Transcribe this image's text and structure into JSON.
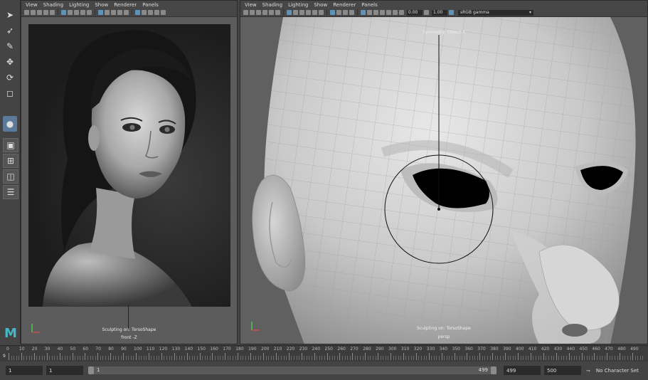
{
  "left_panel": {
    "menu": [
      "View",
      "Shading",
      "Lighting",
      "Show",
      "Renderer",
      "Panels"
    ],
    "status": "Sculpting on: TorsoShape",
    "camera": "front -Z"
  },
  "right_panel": {
    "menu": [
      "View",
      "Shading",
      "Lighting",
      "Show",
      "Renderer",
      "Panels"
    ],
    "exposure": "0.00",
    "gamma": "1.00",
    "color_space": "sRGB gamma",
    "symmetry": "Symmetry: Object X",
    "status": "Sculpting on: TorsoShape",
    "camera": "persp"
  },
  "timeline": {
    "ticks": [
      "0",
      "10",
      "20",
      "30",
      "40",
      "50",
      "60",
      "70",
      "80",
      "90",
      "100",
      "110",
      "120",
      "130",
      "140",
      "150",
      "160",
      "170",
      "180",
      "190",
      "200",
      "210",
      "220",
      "230",
      "240",
      "250",
      "260",
      "270",
      "280",
      "290",
      "300",
      "310",
      "320",
      "330",
      "340",
      "350",
      "360",
      "370",
      "380",
      "390",
      "400",
      "410",
      "420",
      "430",
      "440",
      "450",
      "460",
      "470",
      "480",
      "490"
    ],
    "current_frame": "9"
  },
  "range": {
    "start": "1",
    "anim_start": "1",
    "slider_start": "1",
    "slider_end": "499",
    "end": "499",
    "anim_end": "500",
    "character_set": "No Character Set"
  },
  "logo": "M"
}
